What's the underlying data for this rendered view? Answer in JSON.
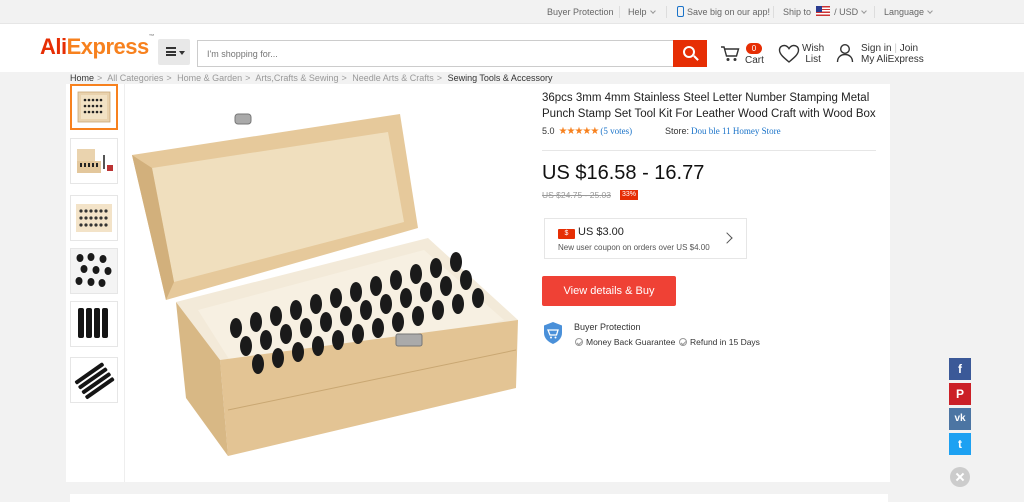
{
  "topbar": {
    "buyer_protection": "Buyer Protection",
    "help": "Help",
    "app_promo": "Save big on our app!",
    "ship_to": "Ship to",
    "slash": "/",
    "currency": "USD",
    "language": "Language"
  },
  "header": {
    "logo_ali": "Ali",
    "logo_express": "Express",
    "logo_tm": "™",
    "search_placeholder": "I'm shopping for...",
    "cart_count": "0",
    "cart_label": "Cart",
    "wish_line1": "Wish",
    "wish_line2": "List",
    "sign_in": "Sign in",
    "join": "Join",
    "account_sep": "|",
    "my_account": "My AliExpress"
  },
  "breadcrumb": [
    "Home",
    "All Categories",
    "Home & Garden",
    "Arts,Crafts & Sewing",
    "Needle Arts & Crafts",
    "Sewing Tools & Accessory"
  ],
  "breadcrumb_sep": ">",
  "product": {
    "title": "36pcs 3mm 4mm Stainless Steel Letter Number Stamping Metal Punch Stamp Set Tool Kit For Leather Wood Craft with Wood Box",
    "rating": "5.0",
    "stars": "★★★★★",
    "votes": "(5 votes)",
    "store_label": "Store:",
    "store_name": "Dou ble 11 Homey Store",
    "price": "US $16.58 - 16.77",
    "original_price": "US $24.75 - 25.03",
    "discount": "33%",
    "coupon_tag": "$",
    "coupon_amount": "US $3.00",
    "coupon_desc": "New user coupon on orders over US $4.00",
    "buy_button": "View details & Buy",
    "protection_title": "Buyer Protection",
    "guarantee_1": "Money Back Guarantee",
    "guarantee_2": "Refund in 15 Days"
  },
  "social": {
    "facebook": "f",
    "pinterest": "P",
    "vk": "vk",
    "twitter": "t"
  },
  "icons": {
    "close": "close-icon"
  },
  "colors": {
    "brand_red": "#e62e04",
    "brand_orange": "#f7811e",
    "buy_button": "#ef4135",
    "link_blue": "#1a73c9",
    "facebook": "#3b5998",
    "pinterest": "#cb2027",
    "vk": "#4c75a3",
    "twitter": "#1da1f2"
  }
}
